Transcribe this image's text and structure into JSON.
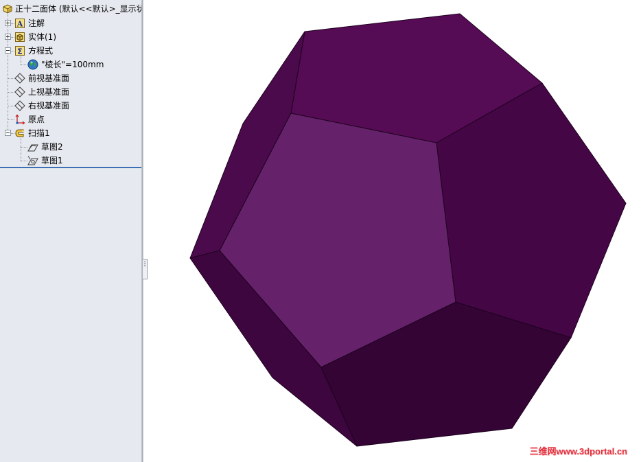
{
  "tree": {
    "root_label": "正十二面体  (默认<<默认>_显示状",
    "items": [
      {
        "label": "注解",
        "icon": "annotation-icon"
      },
      {
        "label": "实体(1)",
        "icon": "solid-bodies-icon"
      },
      {
        "label": "方程式",
        "icon": "equations-icon"
      },
      {
        "label": "\"棱长\"=100mm",
        "icon": "global-variable-icon"
      },
      {
        "label": "前视基准面",
        "icon": "plane-icon"
      },
      {
        "label": "上视基准面",
        "icon": "plane-icon"
      },
      {
        "label": "右视基准面",
        "icon": "plane-icon"
      },
      {
        "label": "原点",
        "icon": "origin-icon"
      },
      {
        "label": "扫描1",
        "icon": "sweep-icon"
      },
      {
        "label": "草图2",
        "icon": "sketch-icon"
      },
      {
        "label": "草图1",
        "icon": "sketch-icon"
      }
    ]
  },
  "splitter": {
    "glyph": "‹‹‹"
  },
  "watermark": {
    "text": "三维网www.3dportal.cn"
  },
  "colors": {
    "face_front": "#65226a",
    "face_top": "#560b55",
    "face_right": "#450646",
    "face_bottom": "#330434",
    "face_bottom_left": "#3d063e",
    "face_left": "#4a0a4b",
    "edge": "#1e0220"
  }
}
